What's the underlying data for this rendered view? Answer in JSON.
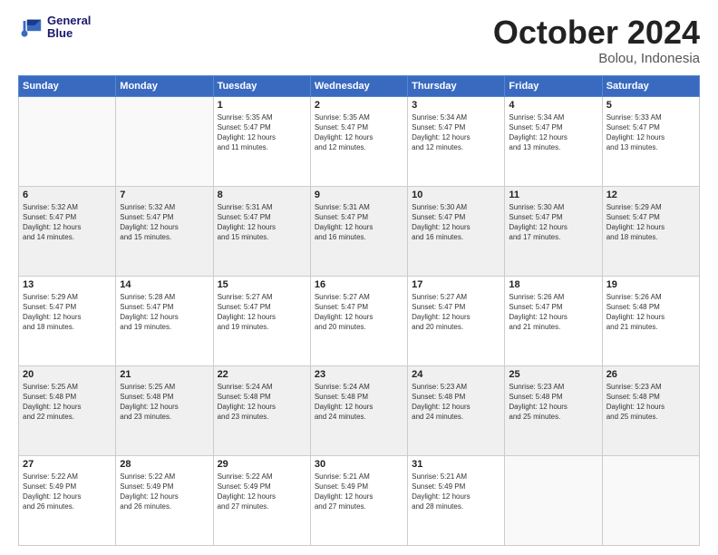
{
  "header": {
    "logo_line1": "General",
    "logo_line2": "Blue",
    "month": "October 2024",
    "location": "Bolou, Indonesia"
  },
  "weekdays": [
    "Sunday",
    "Monday",
    "Tuesday",
    "Wednesday",
    "Thursday",
    "Friday",
    "Saturday"
  ],
  "weeks": [
    [
      {
        "day": "",
        "info": ""
      },
      {
        "day": "",
        "info": ""
      },
      {
        "day": "1",
        "info": "Sunrise: 5:35 AM\nSunset: 5:47 PM\nDaylight: 12 hours\nand 11 minutes."
      },
      {
        "day": "2",
        "info": "Sunrise: 5:35 AM\nSunset: 5:47 PM\nDaylight: 12 hours\nand 12 minutes."
      },
      {
        "day": "3",
        "info": "Sunrise: 5:34 AM\nSunset: 5:47 PM\nDaylight: 12 hours\nand 12 minutes."
      },
      {
        "day": "4",
        "info": "Sunrise: 5:34 AM\nSunset: 5:47 PM\nDaylight: 12 hours\nand 13 minutes."
      },
      {
        "day": "5",
        "info": "Sunrise: 5:33 AM\nSunset: 5:47 PM\nDaylight: 12 hours\nand 13 minutes."
      }
    ],
    [
      {
        "day": "6",
        "info": "Sunrise: 5:32 AM\nSunset: 5:47 PM\nDaylight: 12 hours\nand 14 minutes."
      },
      {
        "day": "7",
        "info": "Sunrise: 5:32 AM\nSunset: 5:47 PM\nDaylight: 12 hours\nand 15 minutes."
      },
      {
        "day": "8",
        "info": "Sunrise: 5:31 AM\nSunset: 5:47 PM\nDaylight: 12 hours\nand 15 minutes."
      },
      {
        "day": "9",
        "info": "Sunrise: 5:31 AM\nSunset: 5:47 PM\nDaylight: 12 hours\nand 16 minutes."
      },
      {
        "day": "10",
        "info": "Sunrise: 5:30 AM\nSunset: 5:47 PM\nDaylight: 12 hours\nand 16 minutes."
      },
      {
        "day": "11",
        "info": "Sunrise: 5:30 AM\nSunset: 5:47 PM\nDaylight: 12 hours\nand 17 minutes."
      },
      {
        "day": "12",
        "info": "Sunrise: 5:29 AM\nSunset: 5:47 PM\nDaylight: 12 hours\nand 18 minutes."
      }
    ],
    [
      {
        "day": "13",
        "info": "Sunrise: 5:29 AM\nSunset: 5:47 PM\nDaylight: 12 hours\nand 18 minutes."
      },
      {
        "day": "14",
        "info": "Sunrise: 5:28 AM\nSunset: 5:47 PM\nDaylight: 12 hours\nand 19 minutes."
      },
      {
        "day": "15",
        "info": "Sunrise: 5:27 AM\nSunset: 5:47 PM\nDaylight: 12 hours\nand 19 minutes."
      },
      {
        "day": "16",
        "info": "Sunrise: 5:27 AM\nSunset: 5:47 PM\nDaylight: 12 hours\nand 20 minutes."
      },
      {
        "day": "17",
        "info": "Sunrise: 5:27 AM\nSunset: 5:47 PM\nDaylight: 12 hours\nand 20 minutes."
      },
      {
        "day": "18",
        "info": "Sunrise: 5:26 AM\nSunset: 5:47 PM\nDaylight: 12 hours\nand 21 minutes."
      },
      {
        "day": "19",
        "info": "Sunrise: 5:26 AM\nSunset: 5:48 PM\nDaylight: 12 hours\nand 21 minutes."
      }
    ],
    [
      {
        "day": "20",
        "info": "Sunrise: 5:25 AM\nSunset: 5:48 PM\nDaylight: 12 hours\nand 22 minutes."
      },
      {
        "day": "21",
        "info": "Sunrise: 5:25 AM\nSunset: 5:48 PM\nDaylight: 12 hours\nand 23 minutes."
      },
      {
        "day": "22",
        "info": "Sunrise: 5:24 AM\nSunset: 5:48 PM\nDaylight: 12 hours\nand 23 minutes."
      },
      {
        "day": "23",
        "info": "Sunrise: 5:24 AM\nSunset: 5:48 PM\nDaylight: 12 hours\nand 24 minutes."
      },
      {
        "day": "24",
        "info": "Sunrise: 5:23 AM\nSunset: 5:48 PM\nDaylight: 12 hours\nand 24 minutes."
      },
      {
        "day": "25",
        "info": "Sunrise: 5:23 AM\nSunset: 5:48 PM\nDaylight: 12 hours\nand 25 minutes."
      },
      {
        "day": "26",
        "info": "Sunrise: 5:23 AM\nSunset: 5:48 PM\nDaylight: 12 hours\nand 25 minutes."
      }
    ],
    [
      {
        "day": "27",
        "info": "Sunrise: 5:22 AM\nSunset: 5:49 PM\nDaylight: 12 hours\nand 26 minutes."
      },
      {
        "day": "28",
        "info": "Sunrise: 5:22 AM\nSunset: 5:49 PM\nDaylight: 12 hours\nand 26 minutes."
      },
      {
        "day": "29",
        "info": "Sunrise: 5:22 AM\nSunset: 5:49 PM\nDaylight: 12 hours\nand 27 minutes."
      },
      {
        "day": "30",
        "info": "Sunrise: 5:21 AM\nSunset: 5:49 PM\nDaylight: 12 hours\nand 27 minutes."
      },
      {
        "day": "31",
        "info": "Sunrise: 5:21 AM\nSunset: 5:49 PM\nDaylight: 12 hours\nand 28 minutes."
      },
      {
        "day": "",
        "info": ""
      },
      {
        "day": "",
        "info": ""
      }
    ]
  ]
}
